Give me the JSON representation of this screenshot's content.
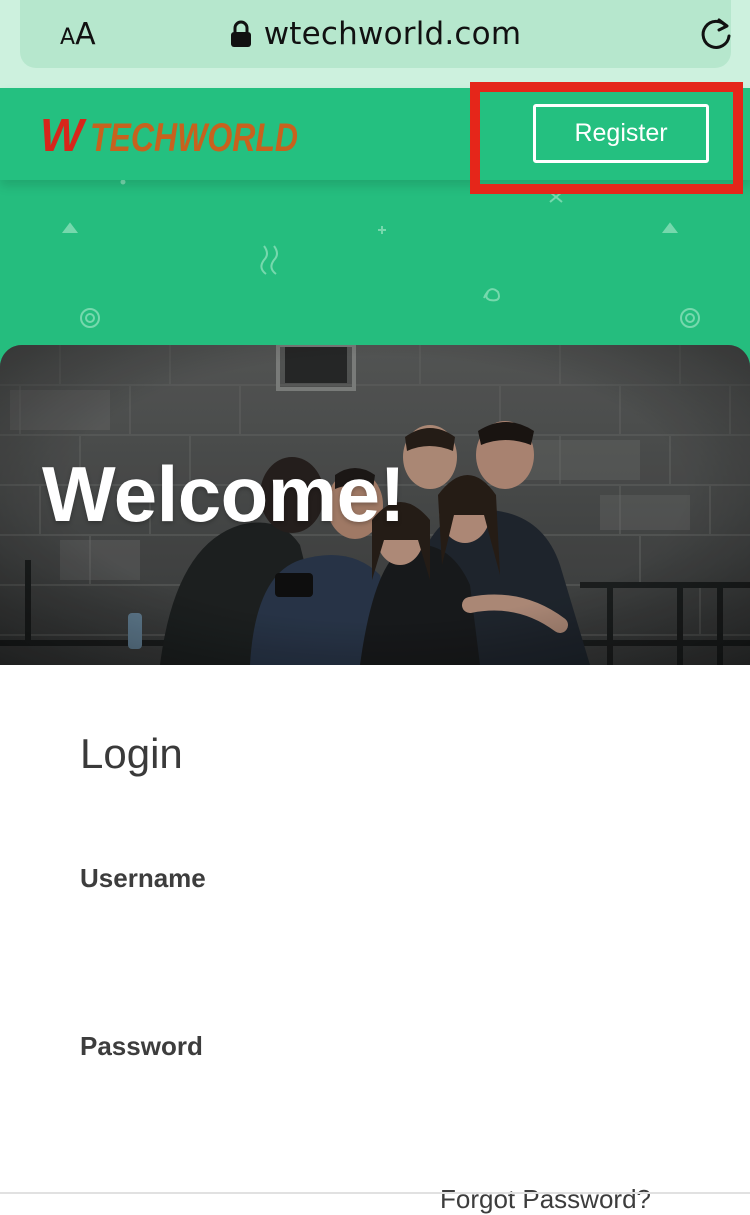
{
  "browser": {
    "text_size_small": "A",
    "text_size_large": "A",
    "url": "wtechworld.com"
  },
  "header": {
    "logo_w": "W",
    "logo_text": "TECHWORLD",
    "register_label": "Register"
  },
  "hero": {
    "welcome": "Welcome!"
  },
  "login": {
    "title": "Login",
    "username_label": "Username",
    "username_value": "",
    "password_label": "Password",
    "password_value": "",
    "forgot_password": "Forgot Password?"
  },
  "colors": {
    "brand_green": "#24c080",
    "browser_bar": "#cdf1de",
    "logo_red": "#d7261b",
    "logo_orange": "#c7621e",
    "highlight_red": "#e5261a"
  },
  "icons": [
    "lock-icon",
    "reload-icon"
  ]
}
